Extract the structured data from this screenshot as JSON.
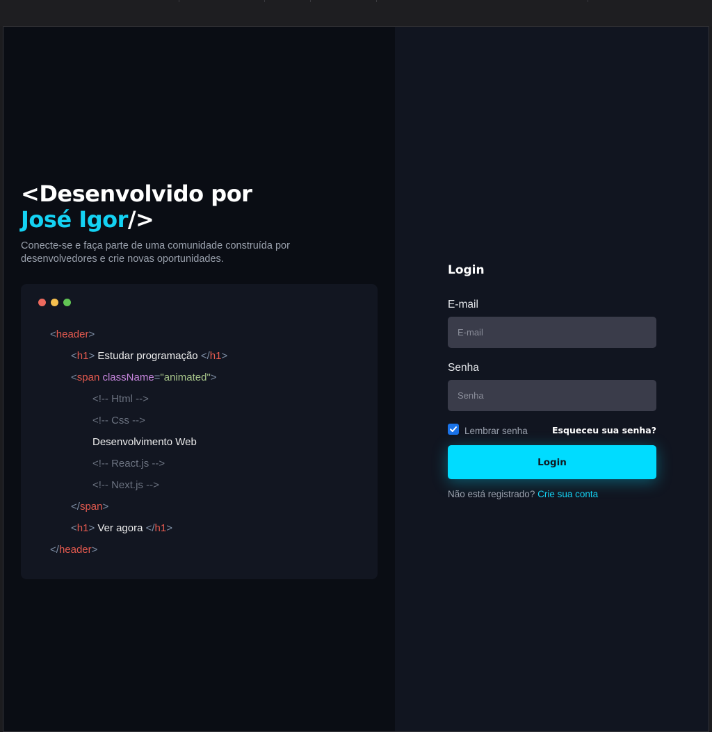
{
  "hero": {
    "title_line1": "<Desenvolvido por",
    "title_name": "José Igor",
    "title_close": "/>",
    "subtitle": "Conecte-se e faça parte de uma comunidade construída por desenvolvedores e crie novas oportunidades."
  },
  "code_window": {
    "dot_colors": [
      "#ed6a5e",
      "#f5bf4f",
      "#61c554"
    ],
    "header_open_tag": "header",
    "h1_tag": "h1",
    "h1_text": "Estudar programação",
    "span_tag": "span",
    "span_attr": "className",
    "span_attr_value": "\"animated\"",
    "comment_html": "<!-- Html -->",
    "comment_css": "<!-- Css -->",
    "dev_text": "Desenvolvimento Web",
    "comment_react": "<!-- React.js -->",
    "comment_next": "<!-- Next.js -->",
    "h1_text_2": "Ver agora"
  },
  "login": {
    "title": "Login",
    "email_label": "E-mail",
    "email_placeholder": "E-mail",
    "password_label": "Senha",
    "password_placeholder": "Senha",
    "remember_label": "Lembrar senha",
    "remember_checked": true,
    "forgot_link": "Esqueceu sua senha?",
    "submit_label": "Login",
    "register_text": "Não está registrado?",
    "register_link": "Crie sua conta"
  },
  "colors": {
    "accent": "#00dcff",
    "name_accent": "#14d2f3",
    "background_left": "#0a0d14",
    "background_right": "#111520",
    "code_card": "#121621",
    "input_bg": "#3a3c4a",
    "checkbox": "#1a73e8"
  }
}
